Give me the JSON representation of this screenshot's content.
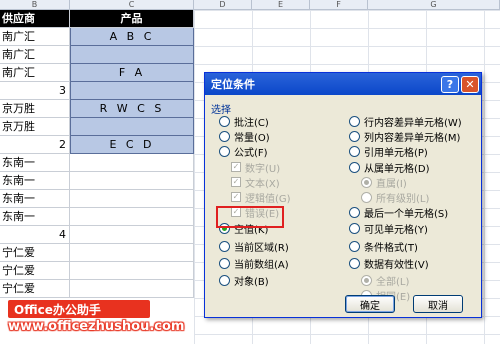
{
  "sheet": {
    "col_headers": [
      "B",
      "C",
      "D",
      "E",
      "F",
      "G"
    ],
    "header_row": {
      "b": "供应商",
      "c": "产品"
    },
    "rows": [
      {
        "b": "南广汇",
        "c": "A B C",
        "b_num": false,
        "sel": true
      },
      {
        "b": "南广汇",
        "c": "",
        "b_num": false,
        "sel": true
      },
      {
        "b": "南广汇",
        "c": "F A",
        "b_num": false,
        "sel": true
      },
      {
        "b": "3",
        "c": "",
        "b_num": true,
        "sel": true
      },
      {
        "b": "京万胜",
        "c": "R W C S",
        "b_num": false,
        "sel": true
      },
      {
        "b": "京万胜",
        "c": "",
        "b_num": false,
        "sel": true
      },
      {
        "b": "2",
        "c": "E C D",
        "b_num": true,
        "sel": true
      },
      {
        "b": "东南一",
        "c": "",
        "b_num": false,
        "sel": false
      },
      {
        "b": "东南一",
        "c": "",
        "b_num": false,
        "sel": false
      },
      {
        "b": "东南一",
        "c": "",
        "b_num": false,
        "sel": false
      },
      {
        "b": "东南一",
        "c": "",
        "b_num": false,
        "sel": false
      },
      {
        "b": "4",
        "c": "",
        "b_num": true,
        "sel": false
      },
      {
        "b": "宁仁爱",
        "c": "",
        "b_num": false,
        "sel": false
      },
      {
        "b": "宁仁爱",
        "c": "",
        "b_num": false,
        "sel": false
      },
      {
        "b": "宁仁爱",
        "c": "",
        "b_num": false,
        "sel": false
      }
    ]
  },
  "dialog": {
    "title": "定位条件",
    "help_btn": "?",
    "close_btn": "✕",
    "section_label": "选择",
    "left_options": [
      {
        "label": "批注(C)",
        "checked": false,
        "disabled": false
      },
      {
        "label": "常量(O)",
        "checked": false,
        "disabled": false
      },
      {
        "label": "公式(F)",
        "checked": false,
        "disabled": false
      },
      {
        "label": "数字(U)",
        "kind": "check",
        "disabled": true
      },
      {
        "label": "文本(X)",
        "kind": "check",
        "disabled": true
      },
      {
        "label": "逻辑值(G)",
        "kind": "check",
        "disabled": true
      },
      {
        "label": "错误(E)",
        "kind": "check",
        "disabled": true
      },
      {
        "label": "空值(K)",
        "checked": true,
        "disabled": false
      },
      {
        "label": "当前区域(R)",
        "checked": false,
        "disabled": false
      },
      {
        "label": "当前数组(A)",
        "checked": false,
        "disabled": false
      },
      {
        "label": "对象(B)",
        "checked": false,
        "disabled": false
      }
    ],
    "right_options": [
      {
        "label": "行内容差异单元格(W)",
        "checked": false,
        "disabled": false
      },
      {
        "label": "列内容差异单元格(M)",
        "checked": false,
        "disabled": false
      },
      {
        "label": "引用单元格(P)",
        "checked": false,
        "disabled": false
      },
      {
        "label": "从属单元格(D)",
        "checked": false,
        "disabled": false
      },
      {
        "label": "直属(I)",
        "checked": true,
        "disabled": true
      },
      {
        "label": "所有级别(L)",
        "checked": false,
        "disabled": true
      },
      {
        "label": "最后一个单元格(S)",
        "checked": false,
        "disabled": false
      },
      {
        "label": "可见单元格(Y)",
        "checked": false,
        "disabled": false
      },
      {
        "label": "条件格式(T)",
        "checked": false,
        "disabled": false
      },
      {
        "label": "数据有效性(V)",
        "checked": false,
        "disabled": false
      },
      {
        "label": "全部(L)",
        "checked": true,
        "disabled": true
      },
      {
        "label": "相同(E)",
        "checked": false,
        "disabled": true
      }
    ],
    "ok_label": "确定",
    "cancel_label": "取消"
  },
  "watermark": {
    "badge": "Office办公助手",
    "url": "www.officezhushou.com"
  },
  "colors": {
    "selection": "#b8c8e4",
    "title_bar": "#0b47c9",
    "highlight": "#e02020",
    "brand": "#e8321f"
  }
}
